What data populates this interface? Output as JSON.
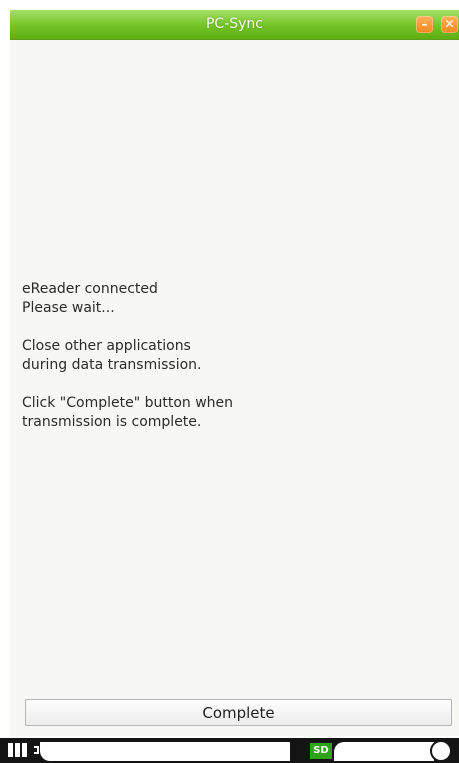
{
  "window": {
    "title": "PC-Sync",
    "minimize_icon": "minimize-icon",
    "close_icon": "close-icon",
    "accent": "#73c326",
    "button_color": "#f2861d"
  },
  "message": {
    "line1": "eReader connected",
    "line2": "Please wait...",
    "line3": "Close other applications",
    "line4": "during data transmission.",
    "line5": "Click \"Complete\" button when",
    "line6": "transmission is complete."
  },
  "complete_button": {
    "label": "Complete"
  },
  "statusbar": {
    "battery_icon": "battery-icon",
    "sd_label": "SD",
    "sd_color": "#2fa31c"
  }
}
